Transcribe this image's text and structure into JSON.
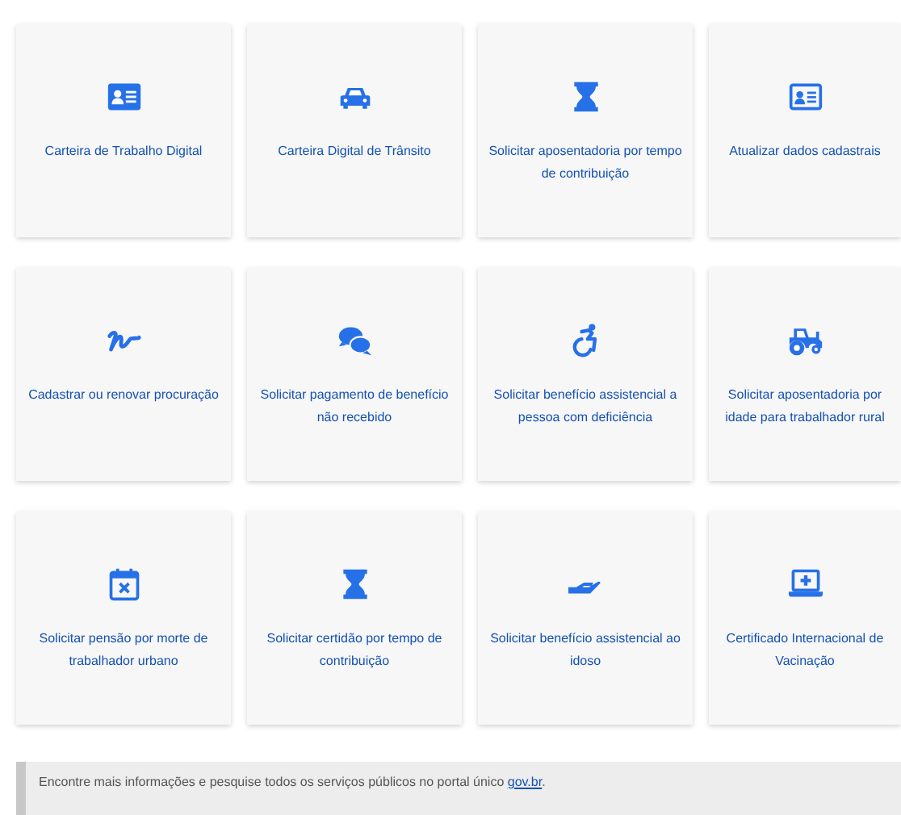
{
  "cards": [
    {
      "label": "Carteira de Trabalho Digital",
      "kind": "id-card"
    },
    {
      "label": "Carteira Digital de Trânsito",
      "kind": "car"
    },
    {
      "label": "Solicitar aposentadoria por tempo de contribuição",
      "kind": "hourglass"
    },
    {
      "label": "Atualizar dados cadastrais",
      "kind": "id-card-outline"
    },
    {
      "label": "Cadastrar ou renovar procuração",
      "kind": "signature"
    },
    {
      "label": "Solicitar pagamento de benefício não recebido",
      "kind": "chat"
    },
    {
      "label": "Solicitar benefício assistencial a pessoa com deficiência",
      "kind": "wheelchair"
    },
    {
      "label": "Solicitar aposentadoria por idade para trabalhador rural",
      "kind": "tractor"
    },
    {
      "label": "Solicitar pensão por morte de trabalhador urbano",
      "kind": "calendar-x"
    },
    {
      "label": "Solicitar certidão por tempo de contribuição",
      "kind": "hourglass"
    },
    {
      "label": "Solicitar benefício assistencial ao idoso",
      "kind": "hand"
    },
    {
      "label": "Certificado Internacional de Vacinação",
      "kind": "laptop-plus"
    }
  ],
  "footer": {
    "text": "Encontre mais informações e pesquise todos os serviços públicos no portal único",
    "link": "gov.br",
    "end": "."
  }
}
